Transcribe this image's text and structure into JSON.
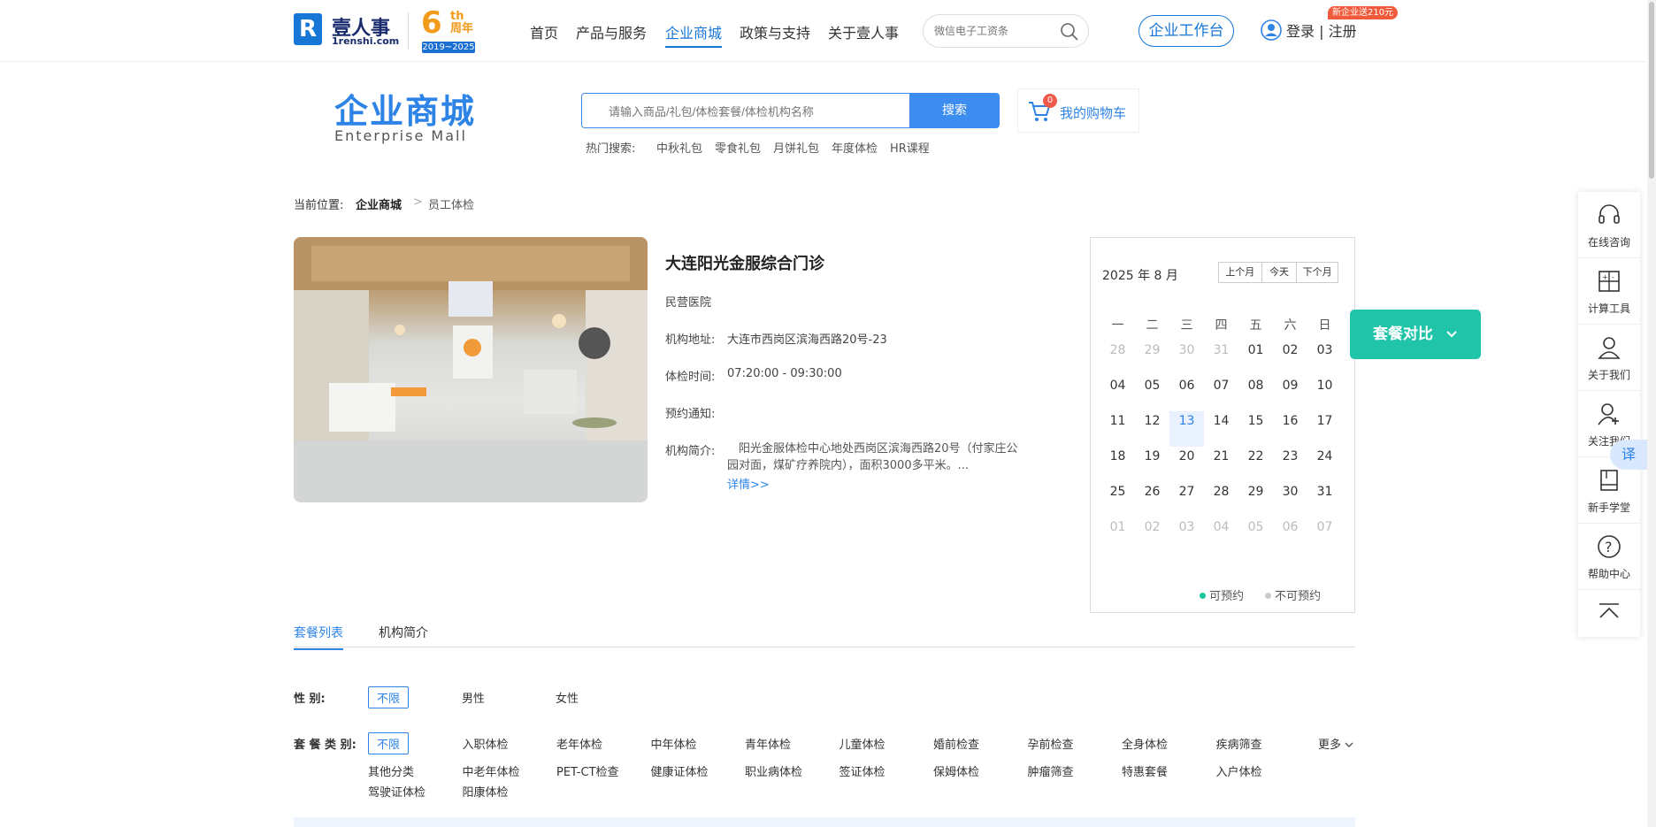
{
  "header": {
    "logo_name": "壹人事",
    "logo_domain": "1renshi.com",
    "anniversary_num": "6",
    "anniversary_th": "th",
    "anniversary_label": "周年",
    "anniversary_years": "2019~2025",
    "nav": [
      "首页",
      "产品与服务",
      "企业商城",
      "政策与支持",
      "关于壹人事"
    ],
    "active_nav": "企业商城",
    "search_placeholder": "微信电子工资条",
    "workbench": "企业工作台",
    "login": "登录 | 注册",
    "new_badge": "新企业送210元"
  },
  "mall": {
    "title": "企业商城",
    "subtitle": "Enterprise  Mall",
    "search_placeholder": "请输入商品/礼包/体检套餐/体检机构名称",
    "search_button": "搜索",
    "cart_label": "我的购物车",
    "cart_count": "0",
    "hot_label": "热门搜索:",
    "hot_terms": [
      "中秋礼包",
      "零食礼包",
      "月饼礼包",
      "年度体检",
      "HR课程"
    ]
  },
  "breadcrumb": {
    "prefix": "当前位置:",
    "home": "企业商城",
    "sep": ">",
    "current": "员工体检"
  },
  "clinic": {
    "name": "大连阳光金服综合门诊",
    "type": "民营医院",
    "address_label": "机构地址:",
    "address": "大连市西岗区滨海西路20号-23",
    "hours_label": "体检时间:",
    "hours": "07:20:00 - 09:30:00",
    "notice_label": "预约通知:",
    "intro_label": "机构简介:",
    "intro": "阳光金服体检中心地处西岗区滨海西路20号（付家庄公园对面，煤矿疗养院内），面积3000多平米。...",
    "more": "详情>>"
  },
  "calendar": {
    "title": "2025 年 8 月",
    "prev": "上个月",
    "today": "今天",
    "next": "下个月",
    "weekdays": [
      "一",
      "二",
      "三",
      "四",
      "五",
      "六",
      "日"
    ],
    "days": [
      {
        "d": "28",
        "m": true
      },
      {
        "d": "29",
        "m": true
      },
      {
        "d": "30",
        "m": true
      },
      {
        "d": "31",
        "m": true
      },
      {
        "d": "01"
      },
      {
        "d": "02"
      },
      {
        "d": "03"
      },
      {
        "d": "04"
      },
      {
        "d": "05"
      },
      {
        "d": "06"
      },
      {
        "d": "07"
      },
      {
        "d": "08"
      },
      {
        "d": "09"
      },
      {
        "d": "10"
      },
      {
        "d": "11"
      },
      {
        "d": "12"
      },
      {
        "d": "13",
        "t": true
      },
      {
        "d": "14"
      },
      {
        "d": "15"
      },
      {
        "d": "16"
      },
      {
        "d": "17"
      },
      {
        "d": "18"
      },
      {
        "d": "19"
      },
      {
        "d": "20"
      },
      {
        "d": "21"
      },
      {
        "d": "22"
      },
      {
        "d": "23"
      },
      {
        "d": "24"
      },
      {
        "d": "25"
      },
      {
        "d": "26"
      },
      {
        "d": "27"
      },
      {
        "d": "28"
      },
      {
        "d": "29"
      },
      {
        "d": "30"
      },
      {
        "d": "31"
      },
      {
        "d": "01",
        "m": true
      },
      {
        "d": "02",
        "m": true
      },
      {
        "d": "03",
        "m": true
      },
      {
        "d": "04",
        "m": true
      },
      {
        "d": "05",
        "m": true
      },
      {
        "d": "06",
        "m": true
      },
      {
        "d": "07",
        "m": true
      }
    ],
    "available": "可预约",
    "unavailable": "不可预约",
    "available_color": "#1bc49a",
    "unavailable_color": "#cccccc"
  },
  "compare_button": "套餐对比",
  "sidebar": {
    "items": [
      "在线咨询",
      "计算工具",
      "关于我们",
      "关注我们",
      "新手学堂",
      "帮助中心"
    ],
    "translate": "译"
  },
  "tabs": [
    "套餐列表",
    "机构简介"
  ],
  "filters": {
    "gender_label": "性    别:",
    "gender_options": [
      "不限",
      "男性",
      "女性"
    ],
    "category_label": "套 餐 类 别:",
    "category_row1": [
      "不限",
      "入职体检",
      "老年体检",
      "中年体检",
      "青年体检",
      "儿童体检",
      "婚前检查",
      "孕前检查",
      "全身体检",
      "疾病筛查"
    ],
    "category_row2": [
      "其他分类",
      "中老年体检",
      "PET-CT检查",
      "健康证体检",
      "职业病体检",
      "签证体检",
      "保姆体检",
      "肿瘤筛查",
      "特惠套餐",
      "入户体检"
    ],
    "category_row3": [
      "驾驶证体检",
      "阳康体检"
    ],
    "more": "更多"
  },
  "colors": {
    "brand": "#2d83e6",
    "accent": "#20c4a9"
  }
}
